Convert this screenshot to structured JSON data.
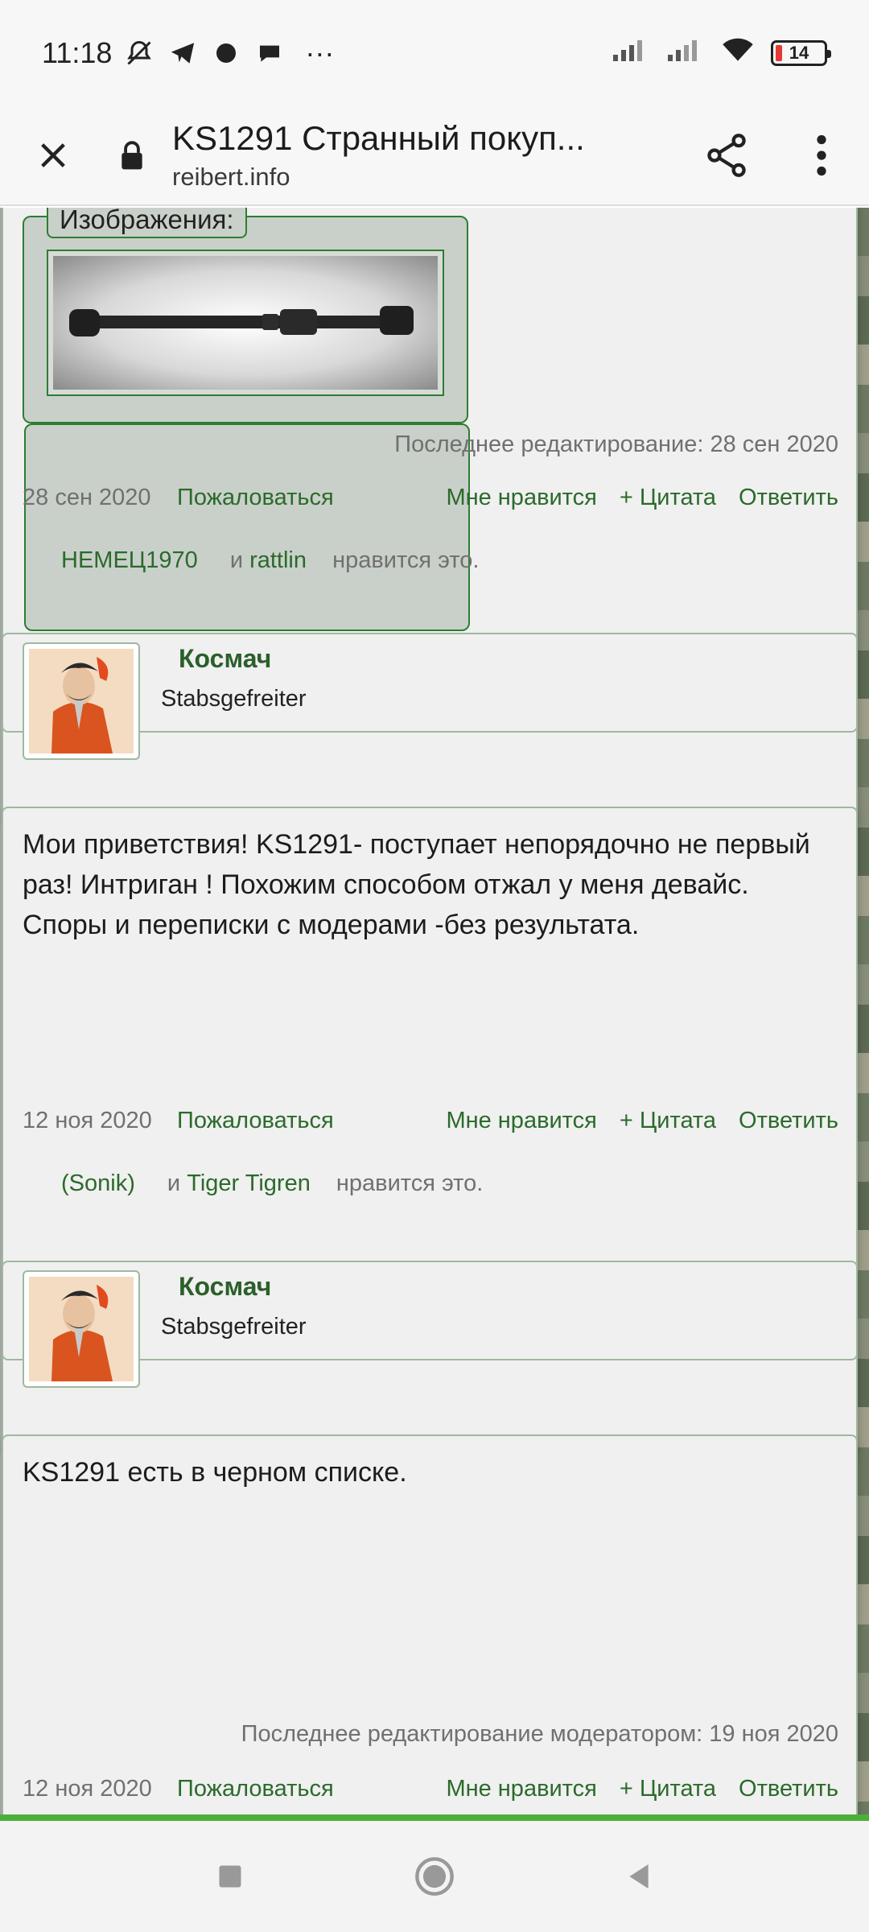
{
  "status_bar": {
    "time": "11:18",
    "more": "···",
    "battery_level": "14",
    "icons": [
      "mute-icon",
      "telegram-icon",
      "app-icon",
      "chat-icon",
      "signal-icon",
      "signal-icon-2",
      "wifi-icon",
      "battery-icon"
    ]
  },
  "toolbar": {
    "title": "KS1291 Странный покуп...",
    "url": "reibert.info",
    "icons": [
      "close-icon",
      "lock-icon",
      "share-icon",
      "more-vert-icon"
    ]
  },
  "post1": {
    "images_label": "Изображения:",
    "edited": "Последнее редактирование: 28 сен 2020",
    "date": "28 сен 2020",
    "report": "Пожаловаться",
    "like": "Мне нравится",
    "quote": "+ Цитата",
    "reply": "Ответить",
    "likers": [
      "НЕМЕЦ1970",
      "rattlin"
    ],
    "likers_join": "и",
    "likes_suffix": "нравится это."
  },
  "user1": {
    "name": "Космач",
    "title": "Stabsgefreiter"
  },
  "post2": {
    "text": "Мои приветствия! KS1291- поступает непорядочно не первый раз! Интриган ! Похожим способом отжал у меня девайс. Споры и переписки с модерами -без результата.",
    "date": "12 ноя 2020",
    "report": "Пожаловаться",
    "like": "Мне нравится",
    "quote": "+ Цитата",
    "reply": "Ответить",
    "likers": [
      "(Sonik)",
      "Tiger Tigren"
    ],
    "likers_join": "и",
    "likes_suffix": "нравится это."
  },
  "user2": {
    "name": "Космач",
    "title": "Stabsgefreiter"
  },
  "post3": {
    "text": "KS1291 есть в черном списке.",
    "edited": "Последнее редактирование модератором: 19 ноя 2020",
    "date": "12 ноя 2020",
    "report": "Пожаловаться",
    "like": "Мне нравится",
    "quote": "+ Цитата",
    "reply": "Ответить"
  },
  "colors": {
    "link_green": "#2b6a2b",
    "border_green": "#2e7d32",
    "progress_green": "#4caf3a"
  }
}
